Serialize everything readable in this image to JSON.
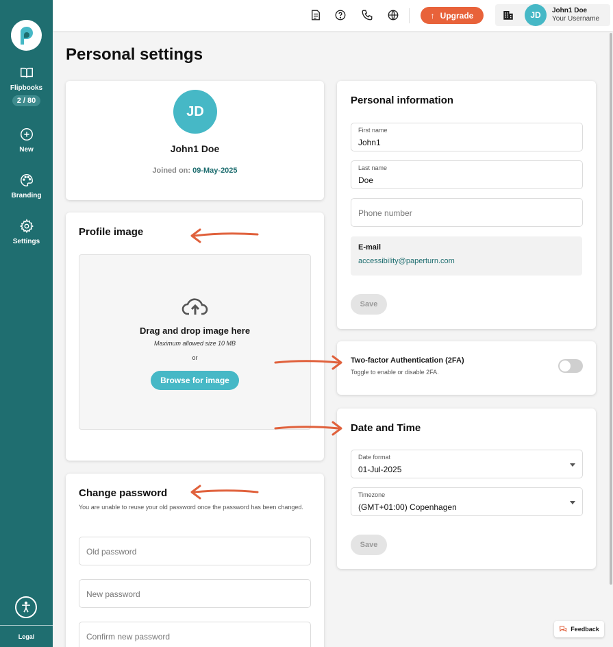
{
  "sidebar": {
    "items": [
      {
        "label": "Flipbooks",
        "badge": "2 / 80"
      },
      {
        "label": "New"
      },
      {
        "label": "Branding"
      },
      {
        "label": "Settings"
      }
    ],
    "legal": "Legal"
  },
  "topbar": {
    "icons": [
      "document-icon",
      "help-icon",
      "phone-icon",
      "globe-icon",
      "building-icon"
    ],
    "upgrade_label": "Upgrade",
    "user": {
      "initials": "JD",
      "name": "John1 Doe",
      "username": "Your Username"
    }
  },
  "page": {
    "title": "Personal settings"
  },
  "profile_card": {
    "initials": "JD",
    "name": "John1 Doe",
    "joined_label": "Joined on:",
    "joined_date": "09-May-2025"
  },
  "profile_image": {
    "title": "Profile image",
    "drop_title": "Drag and drop image here",
    "max_size": "Maximum allowed size 10 MB",
    "or": "or",
    "browse_label": "Browse for image"
  },
  "change_password": {
    "title": "Change password",
    "description": "You are unable to reuse your old password once the password has been changed.",
    "old_placeholder": "Old password",
    "new_placeholder": "New password",
    "confirm_placeholder": "Confirm new password"
  },
  "personal_info": {
    "title": "Personal information",
    "first_name_label": "First name",
    "first_name": "John1",
    "last_name_label": "Last name",
    "last_name": "Doe",
    "phone_placeholder": "Phone number",
    "email_label": "E-mail",
    "email": "accessibility@paperturn.com",
    "save_label": "Save"
  },
  "twofa": {
    "title": "Two-factor Authentication (2FA)",
    "subtitle": "Toggle to enable or disable 2FA.",
    "enabled": false
  },
  "date_time": {
    "title": "Date and Time",
    "date_format_label": "Date format",
    "date_format": "01-Jul-2025",
    "timezone_label": "Timezone",
    "timezone": "(GMT+01:00) Copenhagen",
    "save_label": "Save"
  },
  "feedback_label": "Feedback",
  "colors": {
    "sidebar": "#1f6e70",
    "accent": "#46b8c6",
    "upgrade": "#e8623a",
    "arrow": "#e0613c"
  }
}
